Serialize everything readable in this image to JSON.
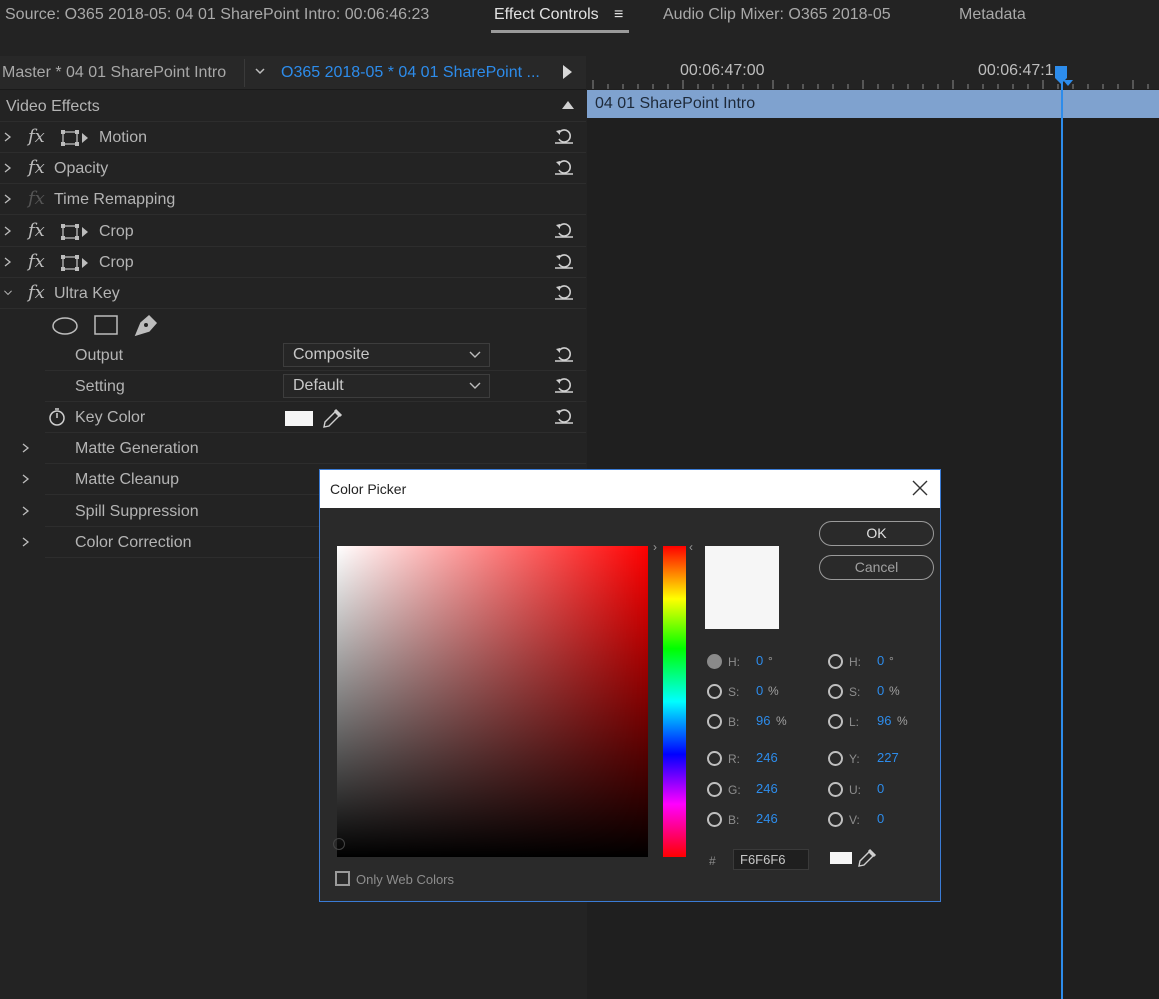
{
  "tabs": {
    "source": "Source: O365 2018-05: 04 01 SharePoint Intro: 00:06:46:23",
    "effect_controls": "Effect Controls",
    "effect_controls_menu": "≡",
    "audio_mixer": "Audio Clip Mixer: O365 2018-05",
    "metadata": "Metadata"
  },
  "effect_controls": {
    "master_label": "Master * 04 01 SharePoint Intro",
    "sequence_label": "O365 2018-05 * 04 01 SharePoint ...",
    "section_title": "Video Effects",
    "effects": [
      {
        "name": "Motion"
      },
      {
        "name": "Opacity"
      },
      {
        "name": "Time Remapping"
      },
      {
        "name": "Crop"
      },
      {
        "name": "Crop"
      },
      {
        "name": "Ultra Key"
      }
    ],
    "fx_glyph": "fx",
    "ultra_key": {
      "output_label": "Output",
      "output_value": "Composite",
      "setting_label": "Setting",
      "setting_value": "Default",
      "key_color_label": "Key Color",
      "key_color_value": "#f6f6f6",
      "groups": [
        "Matte Generation",
        "Matte Cleanup",
        "Spill Suppression",
        "Color Correction"
      ]
    }
  },
  "timeline": {
    "tc1": "00:06:47:00",
    "tc2": "00:06:47:1",
    "clip_name": "04 01 SharePoint Intro"
  },
  "color_picker": {
    "title": "Color Picker",
    "ok": "OK",
    "cancel": "Cancel",
    "hsb": {
      "h_label": "H:",
      "h_value": "0",
      "h_unit": "°",
      "s_label": "S:",
      "s_value": "0",
      "s_unit": "%",
      "b_label": "B:",
      "b_value": "96",
      "b_unit": "%"
    },
    "rgb": {
      "r_label": "R:",
      "r_value": "246",
      "g_label": "G:",
      "g_value": "246",
      "b_label": "B:",
      "b_value": "246"
    },
    "hsl": {
      "h_label": "H:",
      "h_value": "0",
      "h_unit": "°",
      "s_label": "S:",
      "s_value": "0",
      "s_unit": "%",
      "l_label": "L:",
      "l_value": "96",
      "l_unit": "%"
    },
    "yuv": {
      "y_label": "Y:",
      "y_value": "227",
      "u_label": "U:",
      "u_value": "0",
      "v_label": "V:",
      "v_value": "0"
    },
    "hash": "#",
    "hex": "F6F6F6",
    "only_web_colors": "Only Web Colors",
    "current_color": "#f6f6f6"
  },
  "colors": {
    "accent": "#2d8ceb",
    "clip": "#7fa2cf",
    "panel": "#232323"
  }
}
